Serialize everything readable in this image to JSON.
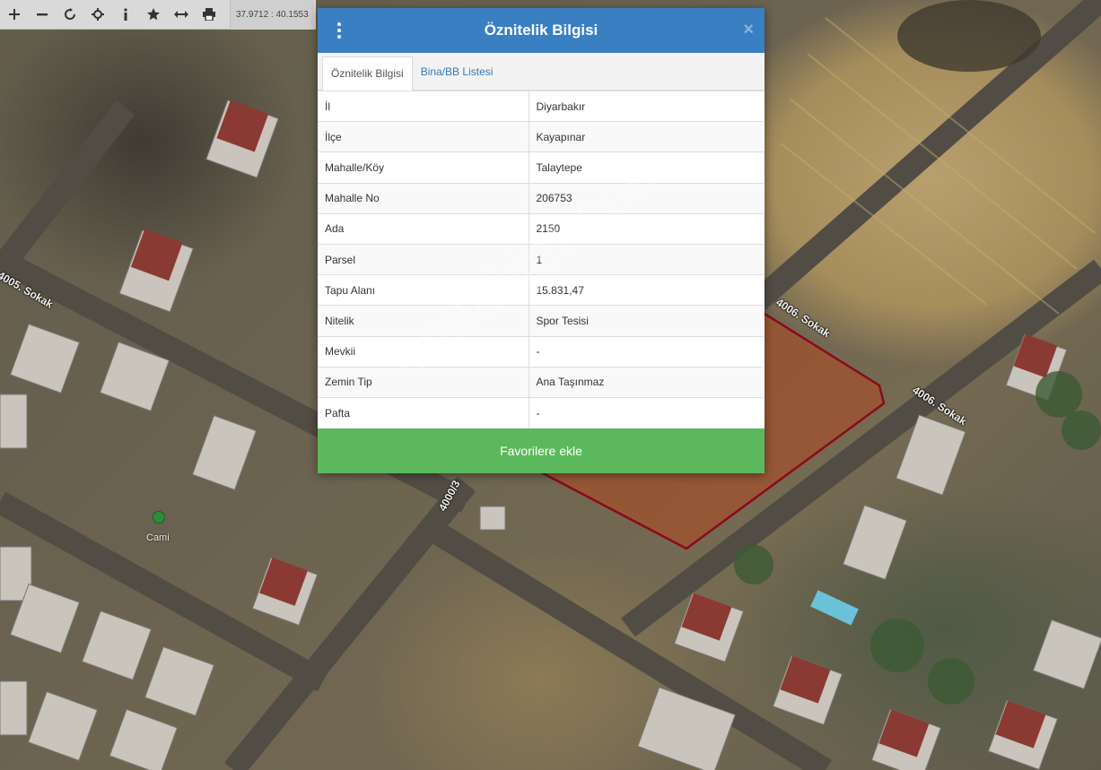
{
  "toolbar": {
    "buttons": [
      {
        "name": "zoom-in",
        "glyph": "+"
      },
      {
        "name": "zoom-out",
        "glyph": "−"
      },
      {
        "name": "refresh",
        "glyph": "⟳"
      },
      {
        "name": "locate",
        "glyph": "⌖"
      },
      {
        "name": "info",
        "glyph": "i"
      },
      {
        "name": "favorite",
        "glyph": "★"
      },
      {
        "name": "measure",
        "glyph": "↔"
      },
      {
        "name": "print",
        "glyph": "⎙"
      }
    ],
    "coordinates": "37.9712 : 40.1553"
  },
  "modal": {
    "title": "Öznitelik Bilgisi",
    "close_glyph": "×",
    "tabs": [
      {
        "label": "Öznitelik Bilgisi",
        "active": true
      },
      {
        "label": "Bina/BB Listesi",
        "active": false
      }
    ],
    "rows": [
      {
        "key": "İl",
        "value": "Diyarbakır"
      },
      {
        "key": "İlçe",
        "value": "Kayapınar"
      },
      {
        "key": "Mahalle/Köy",
        "value": "Talaytepe"
      },
      {
        "key": "Mahalle No",
        "value": "206753"
      },
      {
        "key": "Ada",
        "value": "2150"
      },
      {
        "key": "Parsel",
        "value": "1"
      },
      {
        "key": "Tapu Alanı",
        "value": "15.831,47"
      },
      {
        "key": "Nitelik",
        "value": "Spor Tesisi"
      },
      {
        "key": "Mevkii",
        "value": "-"
      },
      {
        "key": "Zemin Tip",
        "value": "Ana Taşınmaz"
      },
      {
        "key": "Pafta",
        "value": "-"
      }
    ],
    "favorite_button": "Favorilere ekle"
  },
  "map": {
    "street_labels": [
      "4005. Sokak",
      "4006. Sokak",
      "4006. Sokak",
      "4000/3"
    ],
    "poi": {
      "label": "Cami",
      "icon": "mosque-icon"
    },
    "parcel_outline_color": "#8b0a1a",
    "parcel_fill_color": "#a0522d"
  },
  "watermark": "emlakjet.com",
  "colors": {
    "header": "#3a7fc1",
    "favorite_button": "#5cb85c",
    "link_tab": "#337ab7"
  }
}
